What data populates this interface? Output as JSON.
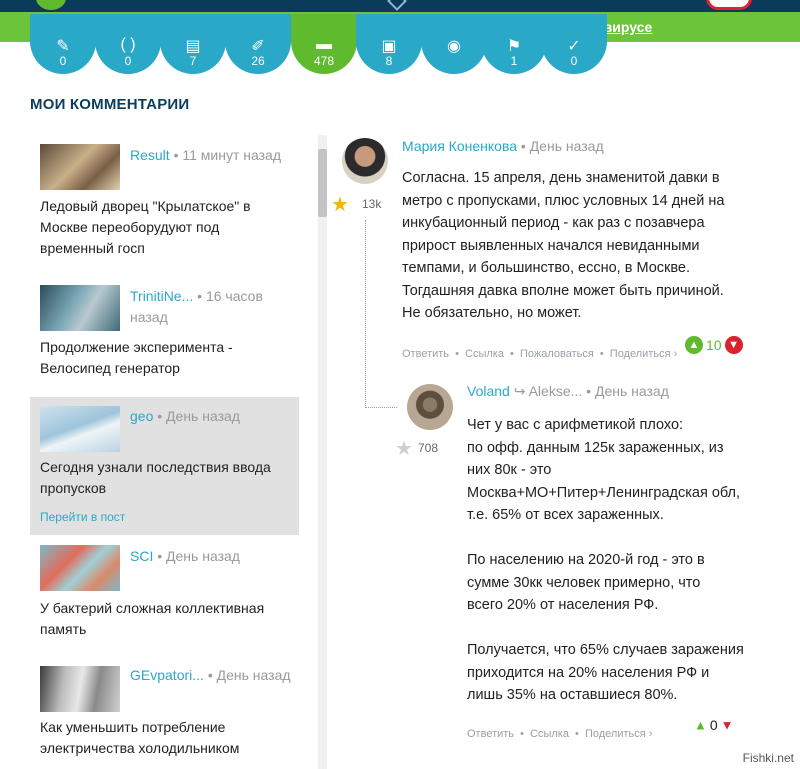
{
  "banner": {
    "link_text": "Все новости о коронавирусе"
  },
  "stats": [
    {
      "icon": "pencil-icon",
      "count": "0"
    },
    {
      "icon": "brackets-icon",
      "count": "0"
    },
    {
      "icon": "grid-icon",
      "count": "7"
    },
    {
      "icon": "pin-icon",
      "count": "26"
    },
    {
      "icon": "comment-icon",
      "count": "478",
      "active": true
    },
    {
      "icon": "comments-icon",
      "count": "8"
    },
    {
      "icon": "eye-icon",
      "count": ""
    },
    {
      "icon": "bookmark-icon",
      "count": "1"
    },
    {
      "icon": "chevron-icon",
      "count": "0"
    }
  ],
  "section_title": "МОИ КОММЕНТАРИИ",
  "my_comments": [
    {
      "author": "Result",
      "time": "11 минут назад",
      "text": "Ледовый дворец \"Крылатское\" в Москве переоборудуют под временный госп"
    },
    {
      "author": "TrinitiNe...",
      "time": "16 часов назад",
      "text": "Продолжение эксперимента - Велосипед генератор"
    },
    {
      "author": "geo",
      "time": "День назад",
      "text": "Сегодня узнали последствия ввода пропусков",
      "link": "Перейти в пост"
    },
    {
      "author": "SCI",
      "time": "День назад",
      "text": "У бактерий сложная коллективная память"
    },
    {
      "author": "GEvpatori...",
      "time": "День назад",
      "text": "Как уменьшить потребление электричества холодильником"
    }
  ],
  "comments": [
    {
      "author": "Мария Коненкова",
      "time": "День назад",
      "rating": "13k",
      "lines": [
        "Согласна. 15 апреля, день знаменитой давки в",
        "метро с пропусками, плюс условных 14 дней на",
        "инкубационный период - как раз с позавчера",
        "прирост выявленных начался невиданными",
        "темпами, и большинство, ессно, в Москве.",
        "Тогдашняя давка вполне может быть причиной.",
        "Не обязательно, но может."
      ],
      "actions": [
        "Ответить",
        "Ссылка",
        "Пожаловаться",
        "Поделиться ›"
      ],
      "votes": "10"
    },
    {
      "author": "Voland",
      "reply_to": "Alekse...",
      "time": "День назад",
      "rating": "708",
      "lines": [
        "Чет у вас с арифметикой плохо:",
        "по офф. данным 125к зараженных, из",
        "них 80к - это",
        "Москва+МО+Питер+Ленинградская обл,",
        "т.е. 65% от всех зараженных.",
        "",
        "По населению на 2020-й год - это в",
        "сумме 30кк человек примерно, что",
        "всего 20% от населения РФ.",
        "",
        "Получается, что 65% случаев заражения",
        "приходится на 20% населения РФ и",
        "лишь 35% на оставшиеся 80%."
      ],
      "actions": [
        "Ответить",
        "Ссылка",
        "Поделиться ›"
      ],
      "votes": "0"
    }
  ],
  "watermark": "Fishki.net",
  "separator": "•",
  "reply_arrow": "↪"
}
